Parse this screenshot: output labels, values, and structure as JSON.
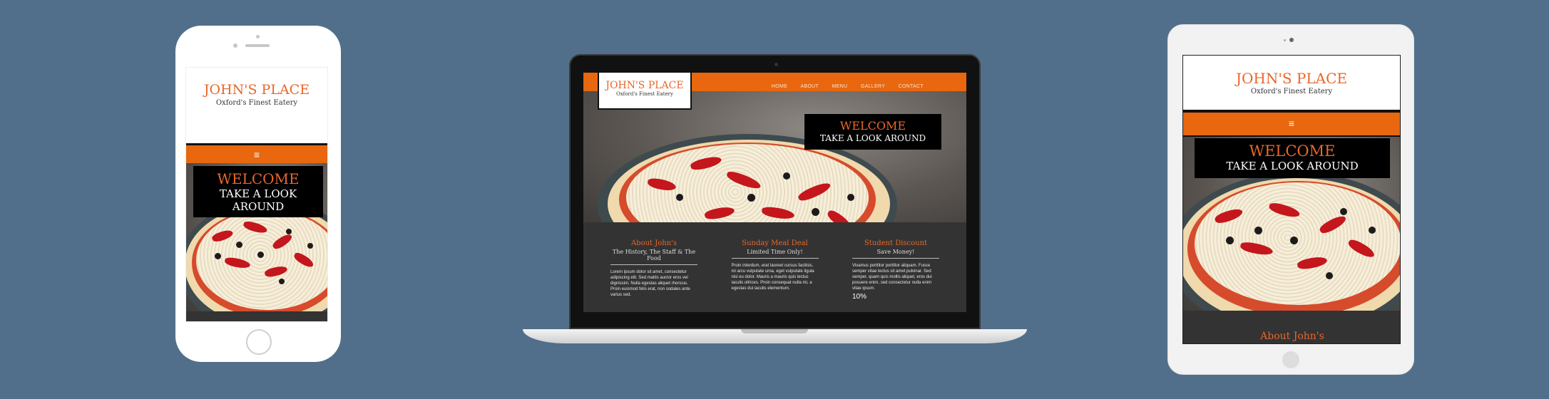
{
  "site": {
    "brand": "JOHN'S PLACE",
    "tagline": "Oxford's Finest Eatery",
    "hamburger": "≡",
    "hero_line1": "WELCOME",
    "hero_line2": "TAKE A LOOK AROUND",
    "nav": [
      "HOME",
      "ABOUT",
      "MENU",
      "GALLERY",
      "CONTACT"
    ],
    "columns": [
      {
        "title": "About John's",
        "subtitle": "The History, The Staff & The Food",
        "body": "Lorem ipsum dolor sit amet, consectetur adipiscing elit. Sed mattis auctor eros vel dignissim. Nulla egestas aliquet rhoncus. Proin euismod felis erat, non sodales ante varius sed."
      },
      {
        "title": "Sunday Meal Deal",
        "subtitle": "Limited Time Only!",
        "body": "Proin interdum, erat laoreet cursus facilisis, mi arcu vulputate urna, eget vulputate ligula nisi eu dolor. Mauris a mauris quis lectus iaculis ultrices. Proin consequat nulla mi, a egestas dui iaculis elementum."
      },
      {
        "title": "Student Discount",
        "subtitle": "Save Money!",
        "body": "Vivamus porttitor porttitor aliquam. Fusce semper vitae lectus sit amet pulvinar. Sed semper, quam quis mollis aliquet, eros dui posuere enim, sed consectetur nulla enim vitae ipsum.",
        "extra": "10%"
      }
    ],
    "tablet_section_title": "About John's"
  },
  "colors": {
    "background": "#516f8b",
    "accent": "#e8672a",
    "nav_bar": "#e8670f",
    "dark": "#333333"
  }
}
